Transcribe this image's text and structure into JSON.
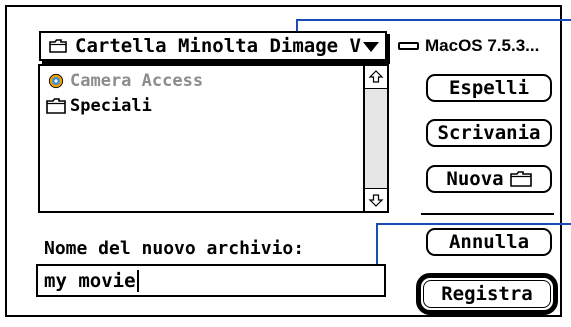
{
  "dialog": {
    "folder_popup": {
      "label": "Cartella Minolta Dimage V",
      "icon": "folder-icon"
    },
    "disk": {
      "label": "MacOS 7.5.3...",
      "icon": "disk-icon"
    },
    "file_list": {
      "items": [
        {
          "label": "Camera Access",
          "icon": "application-icon",
          "enabled": false
        },
        {
          "label": "Speciali",
          "icon": "folder-icon",
          "enabled": true
        }
      ]
    },
    "buttons": {
      "eject": "Espelli",
      "desktop": "Scrivania",
      "new_folder": "Nuova",
      "cancel": "Annulla",
      "save": "Registra"
    },
    "save_as": {
      "label": "Nome del nuovo archivio:",
      "value": "my movie"
    }
  },
  "colors": {
    "callout": "#1b4bb6",
    "disabled_text": "#8c8c8c"
  }
}
